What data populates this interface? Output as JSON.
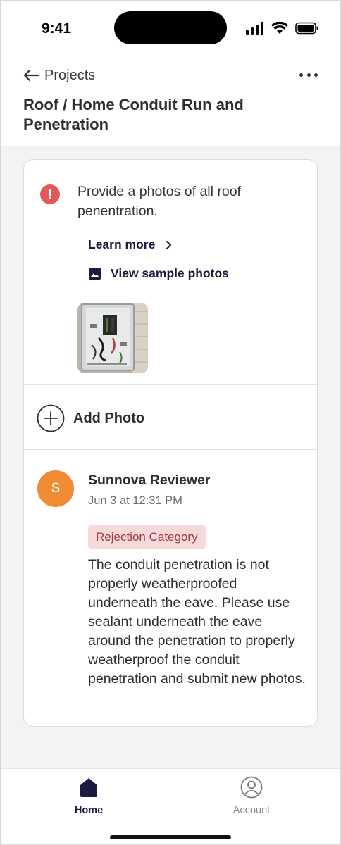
{
  "status_bar": {
    "time": "9:41",
    "icons": [
      "signal-icon",
      "wifi-icon",
      "battery-icon"
    ]
  },
  "header": {
    "back_label": "Projects",
    "title": "Roof / Home Conduit Run and Penetration"
  },
  "task": {
    "instruction": "Provide a photos of all roof penentration.",
    "learn_more_label": "Learn more",
    "view_samples_label": "View sample photos",
    "add_photo_label": "Add Photo"
  },
  "review": {
    "avatar_initial": "S",
    "reviewer_name": "Sunnova Reviewer",
    "timestamp": "Jun 3 at 12:31 PM",
    "category": "Rejection Category",
    "comment": "The conduit penetration is not properly weatherproofed underneath the eave. Please use sealant underneath the eave around the penetration to properly weatherproof the conduit penetration and  submit new photos."
  },
  "bottom_nav": {
    "home_label": "Home",
    "account_label": "Account"
  },
  "colors": {
    "accent": "#1c1b3f",
    "alert": "#e05a5a",
    "avatar": "#f08a33",
    "badge_bg": "#f8d9db",
    "badge_text": "#9c3a42",
    "content_bg": "#f3f3f4"
  }
}
